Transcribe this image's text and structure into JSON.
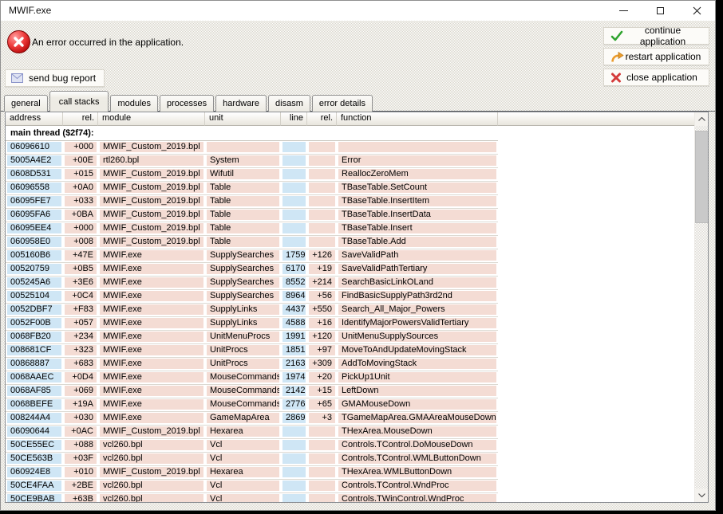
{
  "window": {
    "title": "MWIF.exe"
  },
  "banner": {
    "message": "An error occurred in the application."
  },
  "actions": [
    {
      "label": "continue application",
      "icon": "check-icon"
    },
    {
      "label": "restart application",
      "icon": "restart-arrow-icon"
    },
    {
      "label": "close application",
      "icon": "close-x-icon"
    }
  ],
  "bug_report": {
    "label": "send bug report"
  },
  "tabs": [
    {
      "label": "general"
    },
    {
      "label": "call stacks",
      "active": true
    },
    {
      "label": "modules"
    },
    {
      "label": "processes"
    },
    {
      "label": "hardware"
    },
    {
      "label": "disasm"
    },
    {
      "label": "error details"
    }
  ],
  "call_stack": {
    "columns": [
      "address",
      "rel.",
      "module",
      "unit",
      "line",
      "rel.",
      "function"
    ],
    "thread_header": "main thread ($2f74):",
    "rows": [
      {
        "address": "06096610",
        "rel": "+000",
        "module": "MWIF_Custom_2019.bpl",
        "unit": "",
        "line": "",
        "rel2": "",
        "function": ""
      },
      {
        "address": "5005A4E2",
        "rel": "+00E",
        "module": "rtl260.bpl",
        "unit": "System",
        "line": "",
        "rel2": "",
        "function": "Error"
      },
      {
        "address": "0608D531",
        "rel": "+015",
        "module": "MWIF_Custom_2019.bpl",
        "unit": "Wifutil",
        "line": "",
        "rel2": "",
        "function": "ReallocZeroMem"
      },
      {
        "address": "06096558",
        "rel": "+0A0",
        "module": "MWIF_Custom_2019.bpl",
        "unit": "Table",
        "line": "",
        "rel2": "",
        "function": "TBaseTable.SetCount"
      },
      {
        "address": "06095FE7",
        "rel": "+033",
        "module": "MWIF_Custom_2019.bpl",
        "unit": "Table",
        "line": "",
        "rel2": "",
        "function": "TBaseTable.InsertItem"
      },
      {
        "address": "06095FA6",
        "rel": "+0BA",
        "module": "MWIF_Custom_2019.bpl",
        "unit": "Table",
        "line": "",
        "rel2": "",
        "function": "TBaseTable.InsertData"
      },
      {
        "address": "06095EE4",
        "rel": "+000",
        "module": "MWIF_Custom_2019.bpl",
        "unit": "Table",
        "line": "",
        "rel2": "",
        "function": "TBaseTable.Insert"
      },
      {
        "address": "060958E0",
        "rel": "+008",
        "module": "MWIF_Custom_2019.bpl",
        "unit": "Table",
        "line": "",
        "rel2": "",
        "function": "TBaseTable.Add"
      },
      {
        "address": "005160B6",
        "rel": "+47E",
        "module": "MWIF.exe",
        "unit": "SupplySearches",
        "line": "1759",
        "rel2": "+126",
        "function": "SaveValidPath"
      },
      {
        "address": "00520759",
        "rel": "+0B5",
        "module": "MWIF.exe",
        "unit": "SupplySearches",
        "line": "6170",
        "rel2": "+19",
        "function": "SaveValidPathTertiary"
      },
      {
        "address": "005245A6",
        "rel": "+3E6",
        "module": "MWIF.exe",
        "unit": "SupplySearches",
        "line": "8552",
        "rel2": "+214",
        "function": "SearchBasicLinkOLand"
      },
      {
        "address": "00525104",
        "rel": "+0C4",
        "module": "MWIF.exe",
        "unit": "SupplySearches",
        "line": "8964",
        "rel2": "+56",
        "function": "FindBasicSupplyPath3rd2nd"
      },
      {
        "address": "0052DBF7",
        "rel": "+F83",
        "module": "MWIF.exe",
        "unit": "SupplyLinks",
        "line": "4437",
        "rel2": "+550",
        "function": "Search_All_Major_Powers"
      },
      {
        "address": "0052F00B",
        "rel": "+057",
        "module": "MWIF.exe",
        "unit": "SupplyLinks",
        "line": "4588",
        "rel2": "+16",
        "function": "IdentifyMajorPowersValidTertiary"
      },
      {
        "address": "0068FB20",
        "rel": "+234",
        "module": "MWIF.exe",
        "unit": "UnitMenuProcs",
        "line": "1991",
        "rel2": "+120",
        "function": "UnitMenuSupplySources"
      },
      {
        "address": "008681CF",
        "rel": "+323",
        "module": "MWIF.exe",
        "unit": "UnitProcs",
        "line": "1851",
        "rel2": "+97",
        "function": "MoveToAndUpdateMovingStack"
      },
      {
        "address": "00868887",
        "rel": "+683",
        "module": "MWIF.exe",
        "unit": "UnitProcs",
        "line": "2163",
        "rel2": "+309",
        "function": "AddToMovingStack"
      },
      {
        "address": "0068AAEC",
        "rel": "+0D4",
        "module": "MWIF.exe",
        "unit": "MouseCommands",
        "line": "1974",
        "rel2": "+20",
        "function": "PickUp1Unit"
      },
      {
        "address": "0068AF85",
        "rel": "+069",
        "module": "MWIF.exe",
        "unit": "MouseCommands",
        "line": "2142",
        "rel2": "+15",
        "function": "LeftDown"
      },
      {
        "address": "0068BEFE",
        "rel": "+19A",
        "module": "MWIF.exe",
        "unit": "MouseCommands",
        "line": "2776",
        "rel2": "+65",
        "function": "GMAMouseDown"
      },
      {
        "address": "008244A4",
        "rel": "+030",
        "module": "MWIF.exe",
        "unit": "GameMapArea",
        "line": "2869",
        "rel2": "+3",
        "function": "TGameMapArea.GMAAreaMouseDown"
      },
      {
        "address": "06090644",
        "rel": "+0AC",
        "module": "MWIF_Custom_2019.bpl",
        "unit": "Hexarea",
        "line": "",
        "rel2": "",
        "function": "THexArea.MouseDown"
      },
      {
        "address": "50CE55EC",
        "rel": "+088",
        "module": "vcl260.bpl",
        "unit": "Vcl",
        "line": "",
        "rel2": "",
        "function": "Controls.TControl.DoMouseDown"
      },
      {
        "address": "50CE563B",
        "rel": "+03F",
        "module": "vcl260.bpl",
        "unit": "Vcl",
        "line": "",
        "rel2": "",
        "function": "Controls.TControl.WMLButtonDown"
      },
      {
        "address": "060924E8",
        "rel": "+010",
        "module": "MWIF_Custom_2019.bpl",
        "unit": "Hexarea",
        "line": "",
        "rel2": "",
        "function": "THexArea.WMLButtonDown"
      },
      {
        "address": "50CE4FAA",
        "rel": "+2BE",
        "module": "vcl260.bpl",
        "unit": "Vcl",
        "line": "",
        "rel2": "",
        "function": "Controls.TControl.WndProc"
      },
      {
        "address": "50CE9BAB",
        "rel": "+63B",
        "module": "vcl260.bpl",
        "unit": "Vcl",
        "line": "",
        "rel2": "",
        "function": "Controls.TWinControl.WndProc"
      }
    ]
  },
  "colors": {
    "dialog_bg": "#d8d5ca",
    "dialog_bg_solid": "#edebe4",
    "row_pink": "#f4dcd4",
    "row_blue": "#cfe6f5",
    "error_red": "#d42020",
    "check_green": "#2fa32f",
    "restart_orange": "#eb9c2d",
    "close_red": "#d43b3b",
    "envelope_blue": "#8a93c9"
  }
}
